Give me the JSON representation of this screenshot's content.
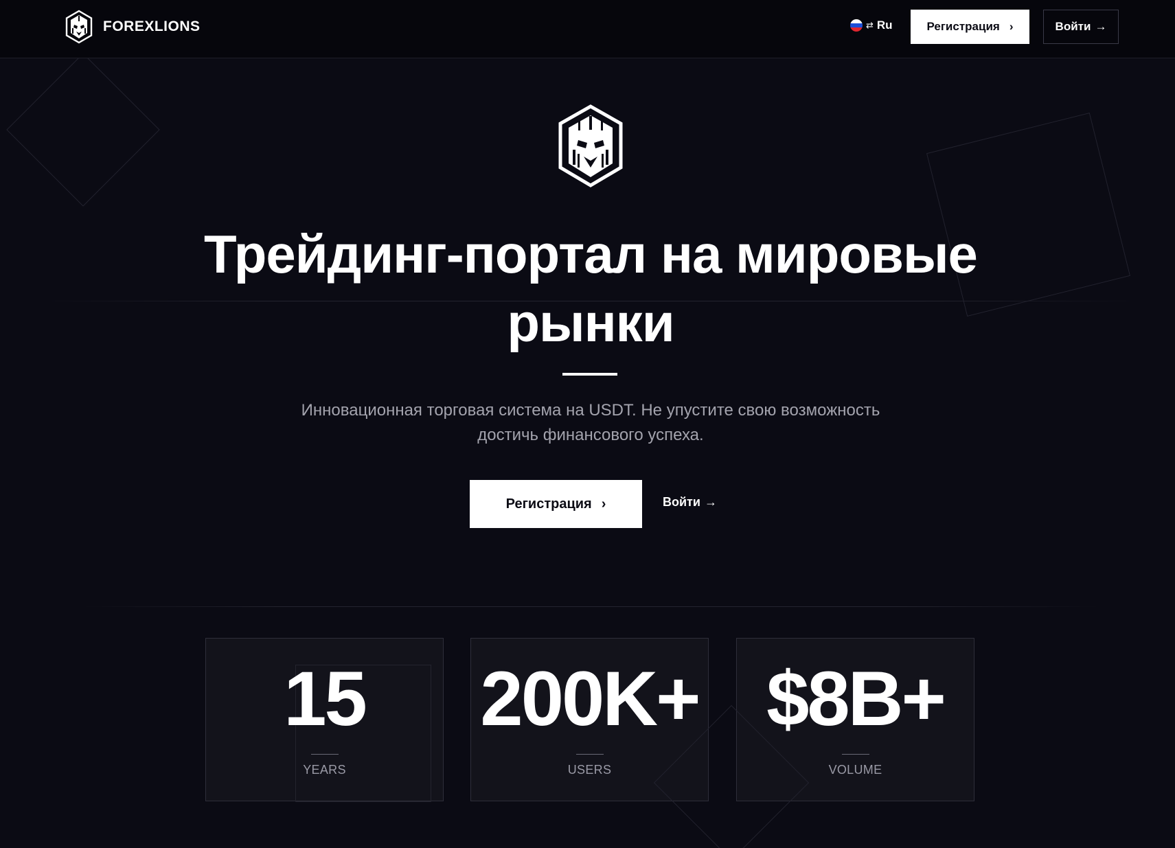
{
  "header": {
    "brand": "FOREXLIONS",
    "language": {
      "label": "Ru",
      "swap_icon": "⇄"
    },
    "register_label": "Регистрация",
    "register_icon": "›",
    "login_label": "Войти",
    "login_icon": "→"
  },
  "hero": {
    "title": "Трейдинг-портал на мировые рынки",
    "subtitle": "Инновационная торговая система на USDT. Не упустите свою возможность достичь финансового успеха.",
    "register_label": "Регистрация",
    "register_icon": "›",
    "login_label": "Войти",
    "login_icon": "→"
  },
  "stats": [
    {
      "value": "15",
      "label": "YEARS"
    },
    {
      "value": "200K+",
      "label": "USERS"
    },
    {
      "value": "$8B+",
      "label": "VOLUME"
    }
  ],
  "colors": {
    "background": "#0b0b14",
    "header_background": "#06060c",
    "card_background": "#13131b",
    "accent": "#ffffff",
    "muted_text": "#a3a3ad"
  }
}
